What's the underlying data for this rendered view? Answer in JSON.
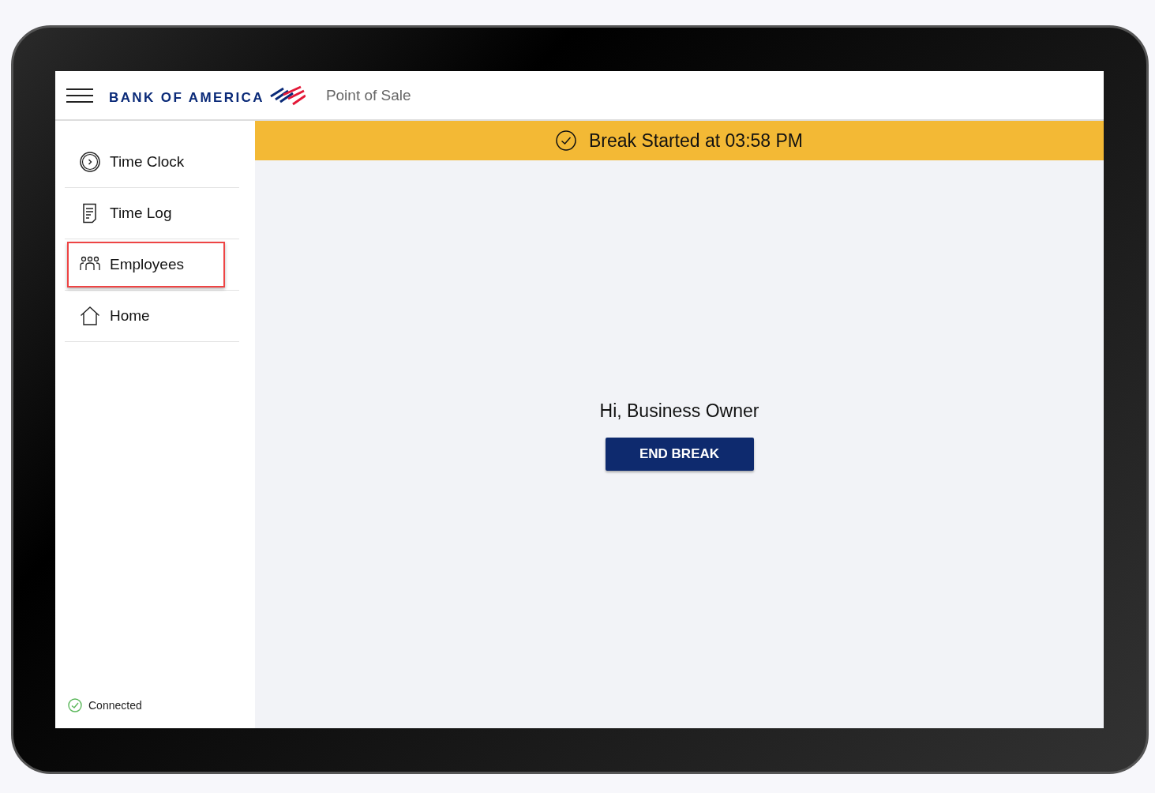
{
  "header": {
    "brand": "BANK OF AMERICA",
    "app_title": "Point of Sale"
  },
  "sidebar": {
    "items": [
      {
        "label": "Time Clock",
        "kind": "clock",
        "highlighted": false
      },
      {
        "label": "Time Log",
        "kind": "document",
        "highlighted": false
      },
      {
        "label": "Employees",
        "kind": "people",
        "highlighted": true
      },
      {
        "label": "Home",
        "kind": "home",
        "highlighted": false
      }
    ],
    "status": "Connected"
  },
  "banner": {
    "text": "Break Started at 03:58 PM"
  },
  "main": {
    "greeting": "Hi, Business Owner",
    "button": "END BREAK"
  }
}
